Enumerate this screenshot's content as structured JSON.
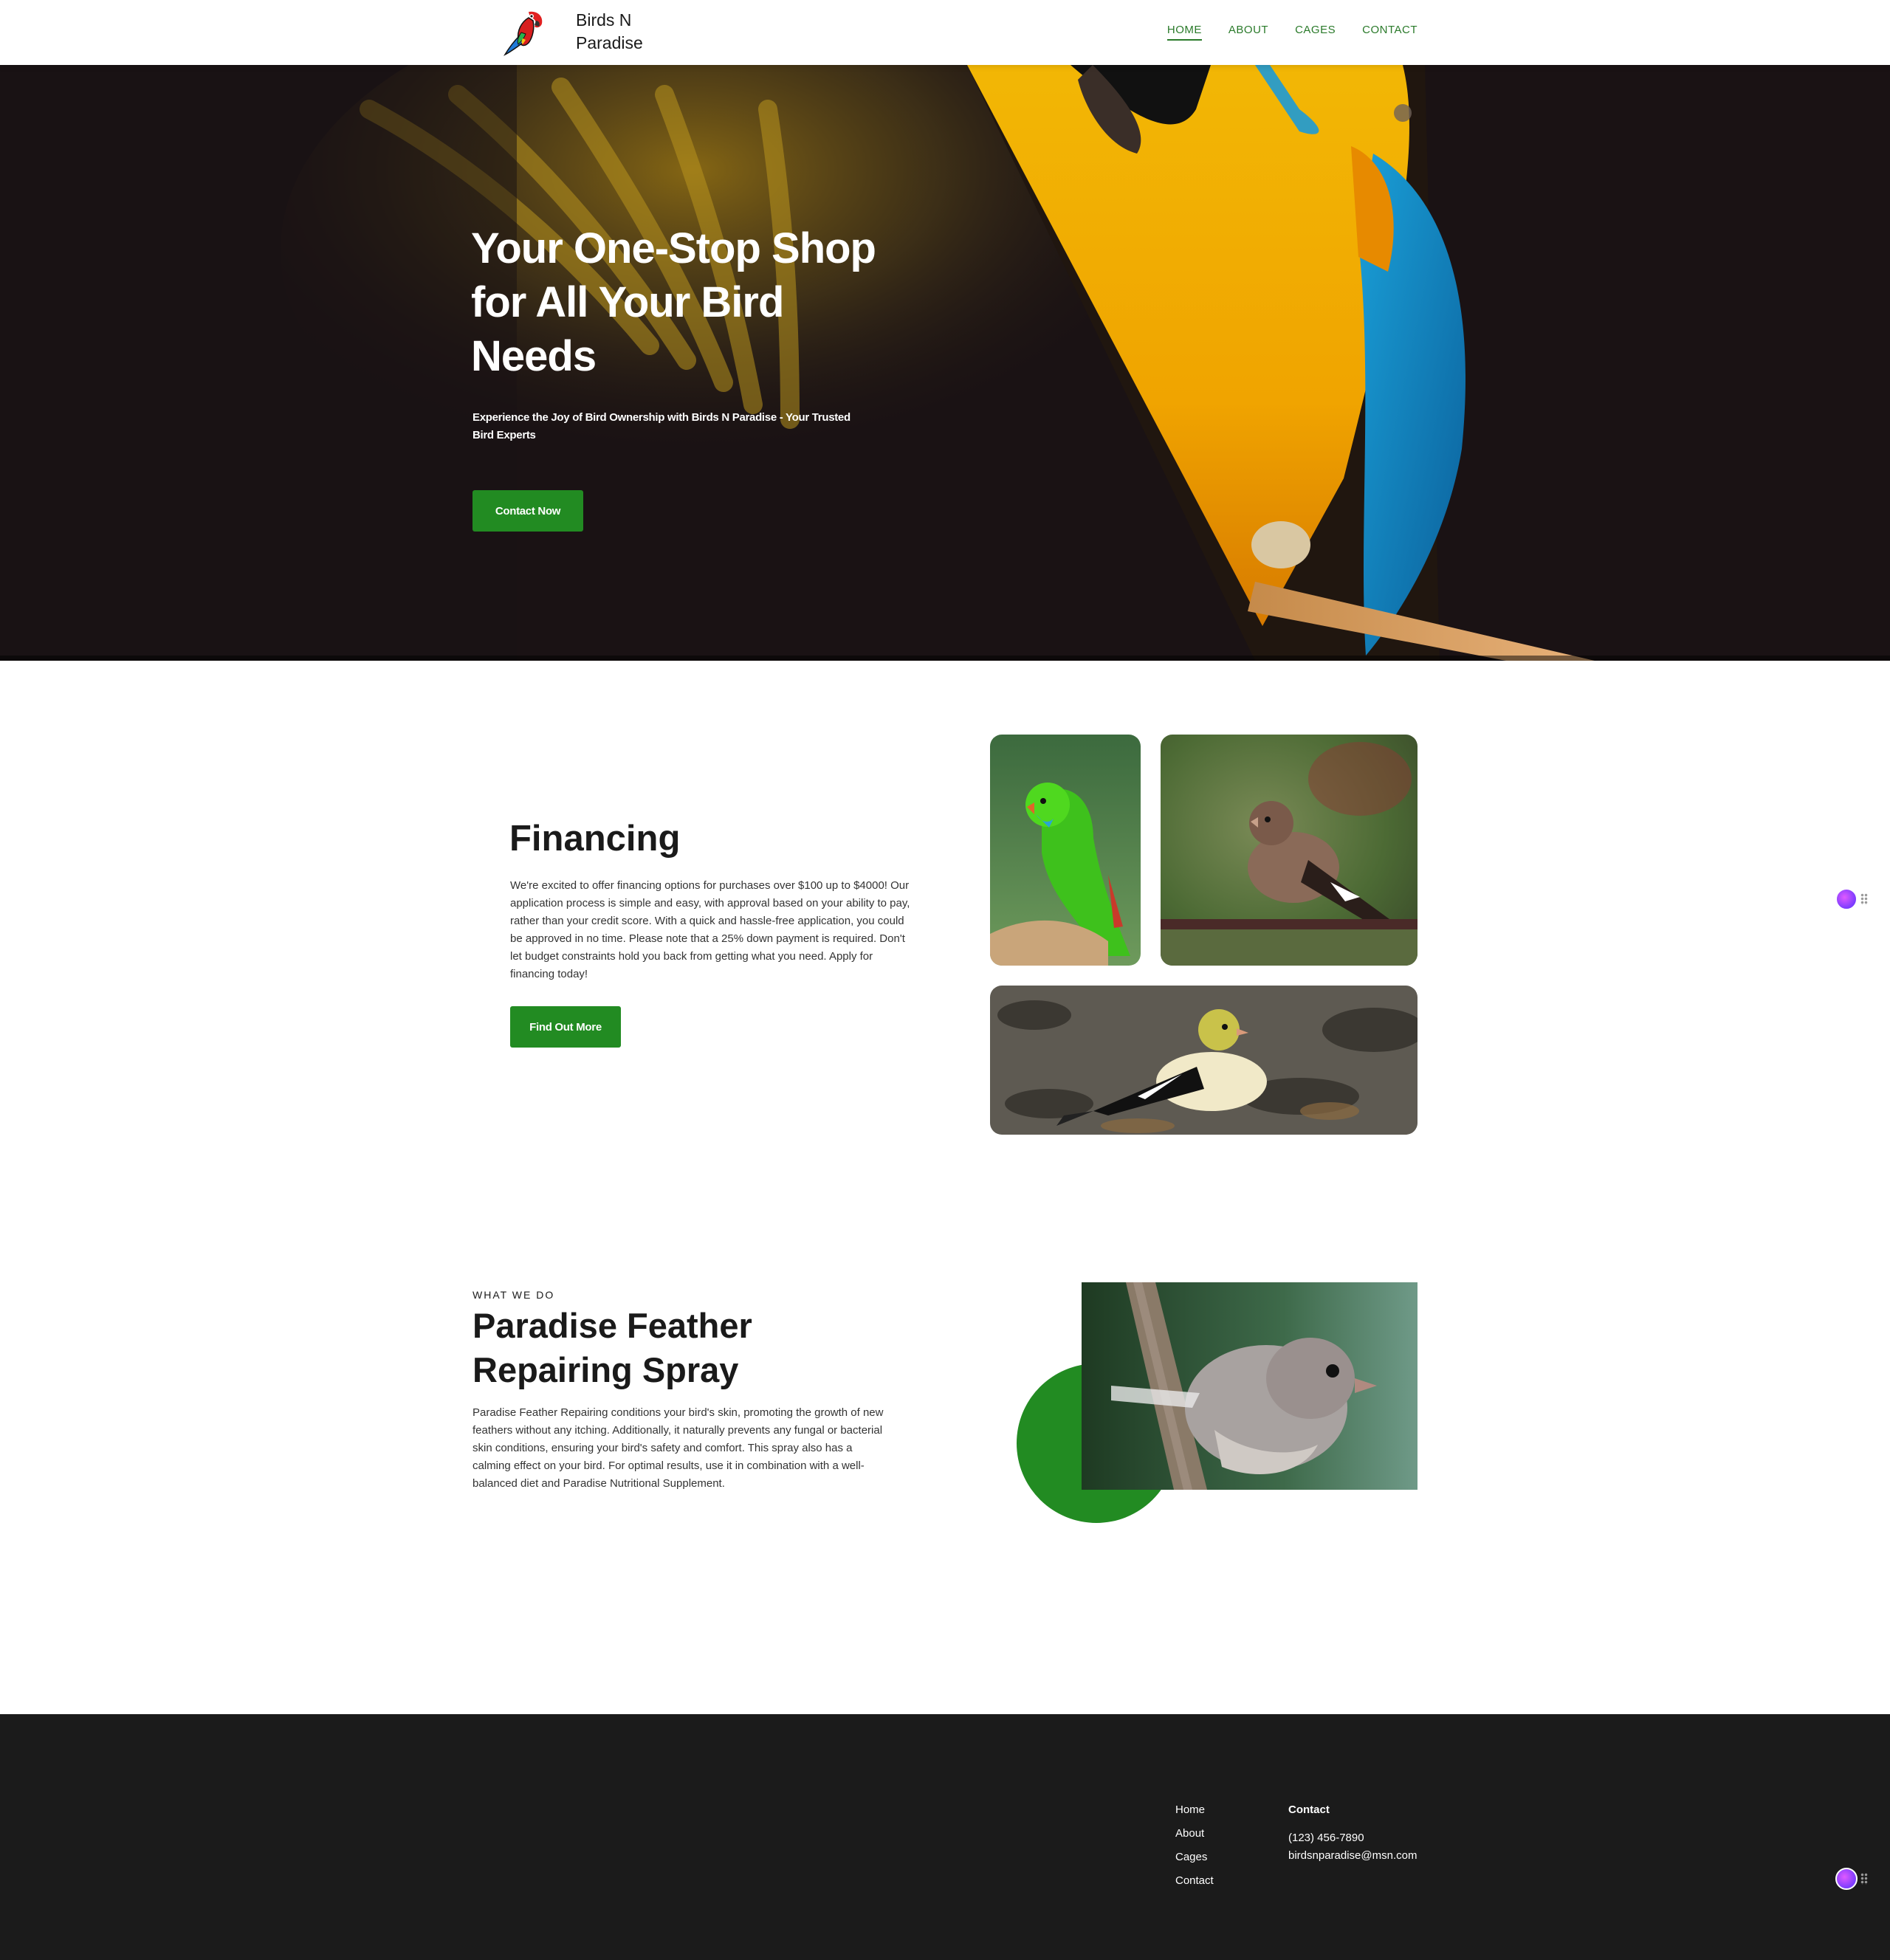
{
  "header": {
    "brand_line1": "Birds N",
    "brand_line2": "Paradise",
    "nav": [
      "HOME",
      "ABOUT",
      "CAGES",
      "CONTACT"
    ]
  },
  "hero": {
    "title": "Your One-Stop Shop for All Your Bird Needs",
    "subtitle": "Experience the Joy of Bird Ownership with Birds N Paradise - Your Trusted Bird Experts",
    "button": "Contact Now"
  },
  "financing": {
    "title": "Financing",
    "text": "We're excited to offer financing options for purchases over $100 up to $4000! Our application process is simple and easy, with approval based on your ability to pay, rather than your credit score. With a quick and hassle-free application, you could be approved in no time. Please note that a 25% down payment is required. Don't let budget constraints hold you back from getting what you need. Apply for financing today!",
    "button": "Find Out More"
  },
  "what_we_do": {
    "eyebrow": "WHAT WE DO",
    "title": "Paradise Feather Repairing Spray",
    "text": "Paradise Feather Repairing conditions your bird's skin, promoting the growth of new feathers without any itching. Additionally, it naturally prevents any fungal or bacterial skin conditions, ensuring your bird's safety and comfort. This spray also has a calming effect on your bird. For optimal results, use it in combination with a well-balanced diet and Paradise Nutritional Supplement."
  },
  "footer": {
    "links": [
      "Home",
      "About",
      "Cages",
      "Contact"
    ],
    "contact_heading": "Contact",
    "phone": "(123) 456-7890",
    "email": "birdsnparadise@msn.com"
  },
  "colors": {
    "accent": "#228b22",
    "nav_text": "#2a7a2a",
    "footer_bg": "#1b1b1b"
  }
}
